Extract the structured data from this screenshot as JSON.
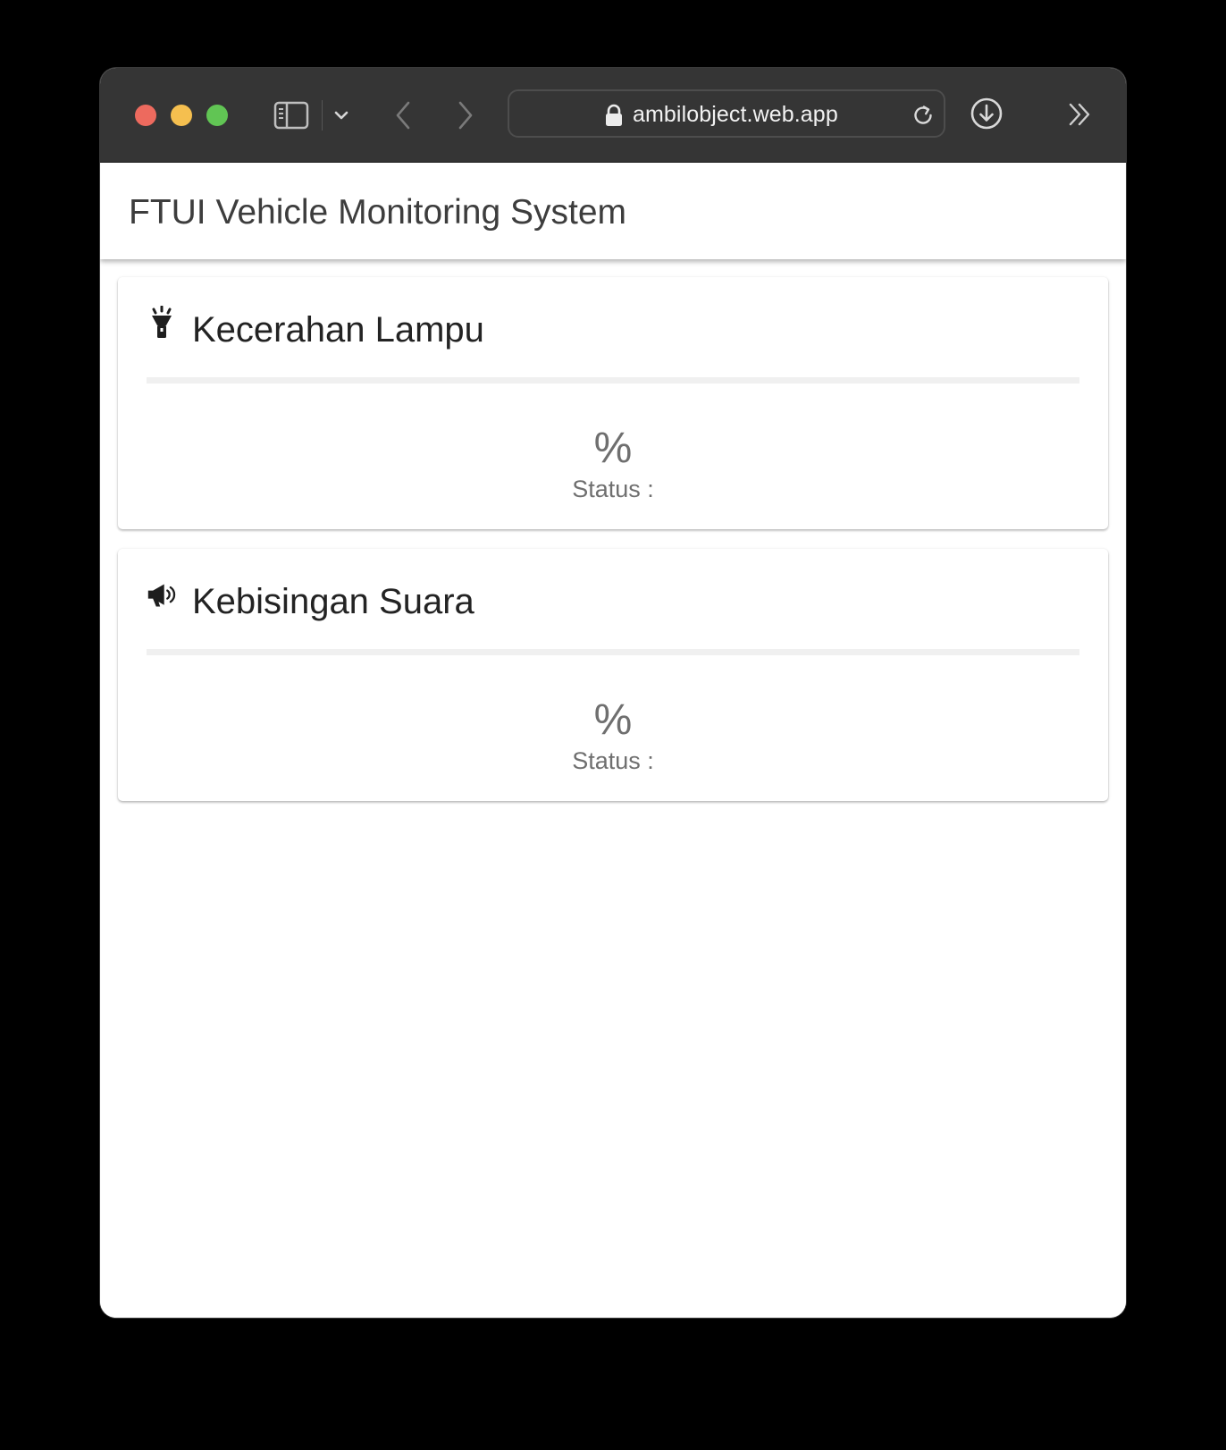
{
  "browser": {
    "url": "ambilobject.web.app",
    "icons": {
      "sidebar": "sidebar-icon",
      "chevron": "chevron-down-icon",
      "back": "back-arrow-icon",
      "forward": "forward-arrow-icon",
      "lock": "lock-icon",
      "reload": "reload-icon",
      "download": "download-icon",
      "more": "double-chevron-right-icon"
    },
    "traffic_colors": {
      "close": "#ed6a5e",
      "minimize": "#f5bf4f",
      "maximize": "#61c554"
    }
  },
  "app": {
    "title": "FTUI Vehicle Monitoring System"
  },
  "cards": [
    {
      "icon": "flashlight-icon",
      "title": "Kecerahan Lampu",
      "value": "%",
      "status": "Status :"
    },
    {
      "icon": "megaphone-icon",
      "title": "Kebisingan Suara",
      "value": "%",
      "status": "Status :"
    }
  ]
}
